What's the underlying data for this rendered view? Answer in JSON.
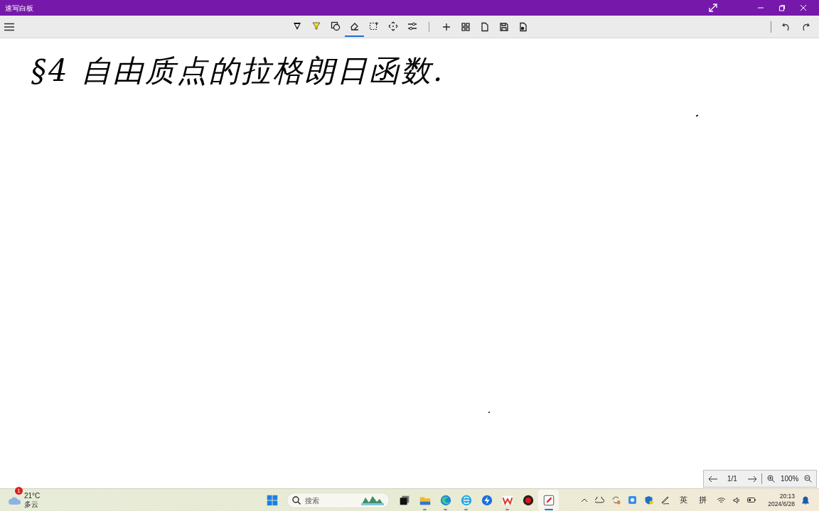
{
  "window": {
    "title": "速写白板"
  },
  "toolbar": {
    "tools": [
      {
        "kind": "pen",
        "selected": false
      },
      {
        "kind": "highlighter",
        "selected": false
      },
      {
        "kind": "shapes",
        "selected": false
      },
      {
        "kind": "eraser",
        "selected": true
      },
      {
        "kind": "select",
        "selected": false
      },
      {
        "kind": "move",
        "selected": false
      },
      {
        "kind": "settings",
        "selected": false
      }
    ],
    "actions": [
      {
        "kind": "add"
      },
      {
        "kind": "grid"
      },
      {
        "kind": "page"
      },
      {
        "kind": "save"
      },
      {
        "kind": "export"
      }
    ]
  },
  "canvas": {
    "ink": "§4  自由质点的拉格朗日函数."
  },
  "pager": {
    "page": "1/1",
    "zoom": "100%"
  },
  "taskbar": {
    "weather": {
      "badge": "1",
      "temperature": "21°C",
      "condition": "多云"
    },
    "search": {
      "placeholder": "搜索"
    },
    "apps": [
      {
        "kind": "start",
        "running": false,
        "active": false
      },
      {
        "kind": "taskview",
        "running": false,
        "active": false
      },
      {
        "kind": "folder",
        "running": true,
        "active": false
      },
      {
        "kind": "edge",
        "running": true,
        "active": false
      },
      {
        "kind": "edgedev",
        "running": true,
        "active": false
      },
      {
        "kind": "feather",
        "running": false,
        "active": false
      },
      {
        "kind": "wps",
        "running": true,
        "active": false
      },
      {
        "kind": "record",
        "running": false,
        "active": false
      },
      {
        "kind": "whiteboard",
        "running": true,
        "active": true
      }
    ],
    "input_methods": [
      "英",
      "拼"
    ],
    "time": "20:13",
    "date": "2024/6/28"
  }
}
